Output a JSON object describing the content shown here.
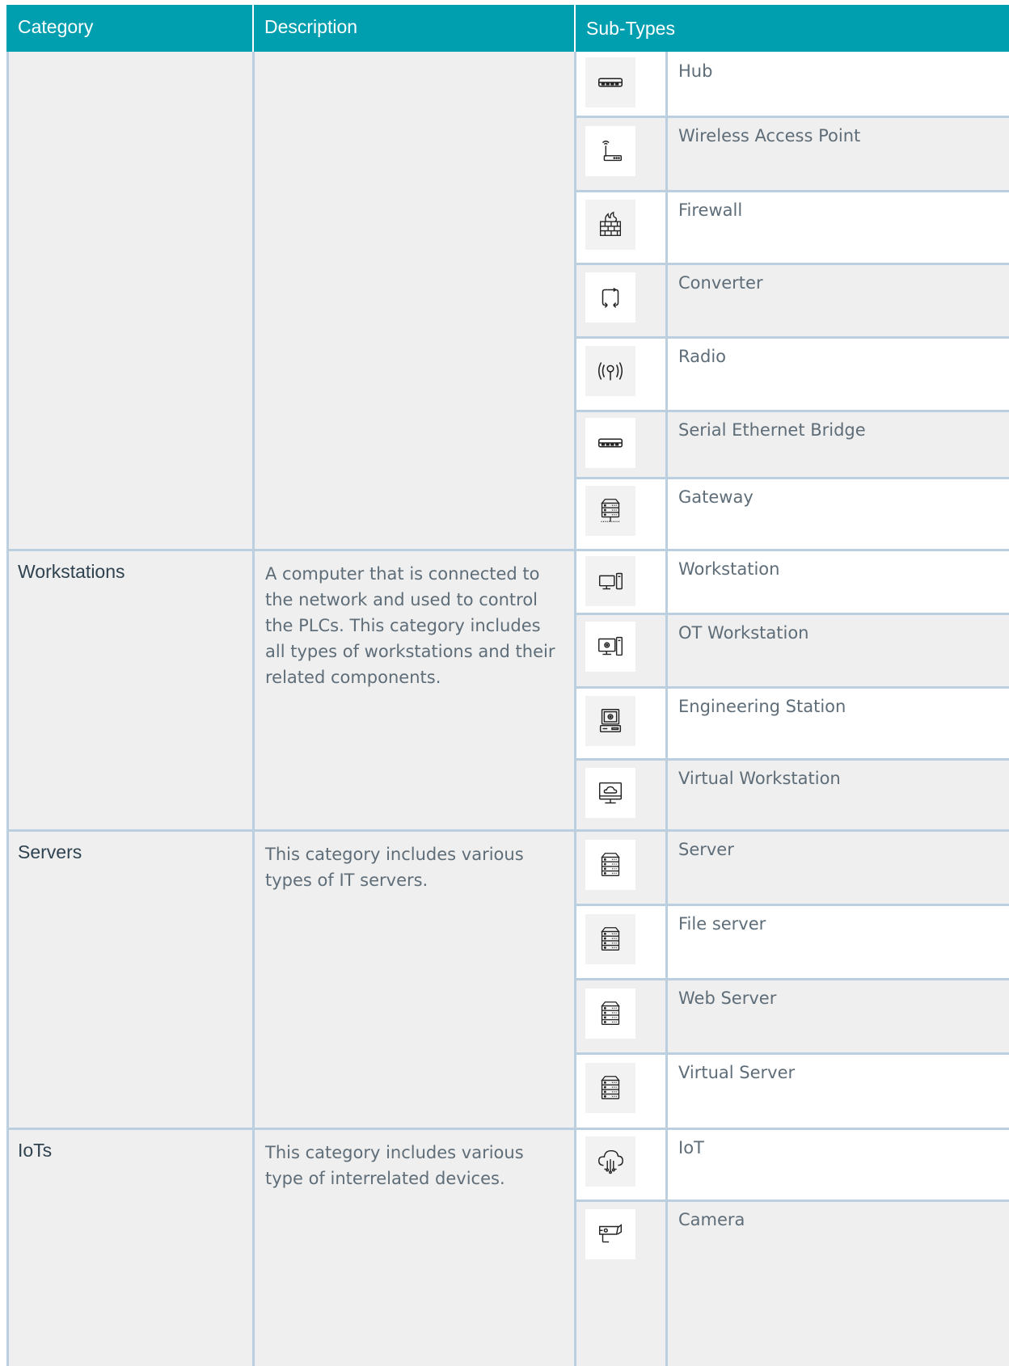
{
  "header": {
    "category": "Category",
    "description": "Description",
    "subtypes": "Sub-Types"
  },
  "groups": [
    {
      "category": "",
      "description": "",
      "subtypes": [
        {
          "label": "Hub",
          "icon": "hub-icon"
        },
        {
          "label": "Wireless Access Point",
          "icon": "wireless-access-point-icon"
        },
        {
          "label": "Firewall",
          "icon": "firewall-icon"
        },
        {
          "label": "Converter",
          "icon": "converter-icon"
        },
        {
          "label": "Radio",
          "icon": "radio-icon"
        },
        {
          "label": "Serial Ethernet Bridge",
          "icon": "serial-ethernet-bridge-icon"
        },
        {
          "label": "Gateway",
          "icon": "gateway-icon"
        }
      ]
    },
    {
      "category": "Workstations",
      "description": "A computer that is connected to the network and used to control the PLCs. This category includes all types of workstations and their related components.",
      "subtypes": [
        {
          "label": "Workstation",
          "icon": "workstation-icon"
        },
        {
          "label": "OT Workstation",
          "icon": "ot-workstation-icon"
        },
        {
          "label": "Engineering Station",
          "icon": "engineering-station-icon"
        },
        {
          "label": "Virtual Workstation",
          "icon": "virtual-workstation-icon"
        }
      ]
    },
    {
      "category": "Servers",
      "description": "This category includes various types of IT servers.",
      "subtypes": [
        {
          "label": "Server",
          "icon": "server-icon"
        },
        {
          "label": "File server",
          "icon": "file-server-icon"
        },
        {
          "label": "Web Server",
          "icon": "web-server-icon"
        },
        {
          "label": "Virtual Server",
          "icon": "virtual-server-icon"
        }
      ]
    },
    {
      "category": "IoTs",
      "description": "This category includes various type of interrelated devices.",
      "subtypes": [
        {
          "label": "IoT",
          "icon": "iot-icon"
        },
        {
          "label": "Camera",
          "icon": "camera-icon"
        }
      ]
    }
  ],
  "colors": {
    "header_bg": "#009fb0",
    "grid_line": "#bccfe0",
    "cell_grey": "#efefef",
    "text": "#5e6d78"
  }
}
